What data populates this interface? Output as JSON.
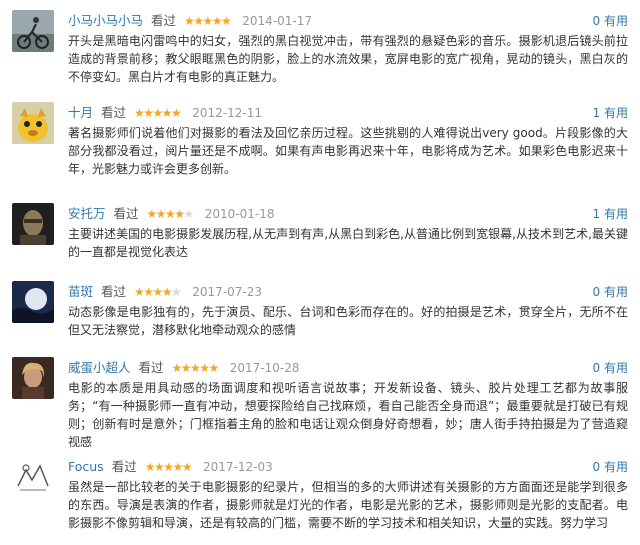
{
  "reviews": [
    {
      "user": "小马小马小马",
      "verb": "看过",
      "rating": 5,
      "date": "2014-01-17",
      "useful": "0 有用",
      "avatar": "cyclist-photo",
      "text": "开头是黑暗电闪雷鸣中的妇女，强烈的黑白视觉冲击，带有强烈的悬疑色彩的音乐。摄影机退后镜头前拉造成的背景前移；教父眼眶黑色的阴影，脸上的水流效果，宽屏电影的宽广视角，晃动的镜头，黑白灰的不停变幻。黑白片才有电影的真正魅力。"
    },
    {
      "user": "十月",
      "verb": "看过",
      "rating": 5,
      "date": "2012-12-11",
      "useful": "1 有用",
      "avatar": "yellow-mascot",
      "text": "著名摄影师们说着他们对摄影的看法及回忆亲历过程。这些挑剔的人难得说出very good。片段影像的大部分我都没看过，阅片量还是不成啊。如果有声电影再迟来十年，电影将成为艺术。如果彩色电影迟来十年，光影魅力或许会更多创新。"
    },
    {
      "user": "安托万",
      "verb": "看过",
      "rating": 4,
      "date": "2010-01-18",
      "useful": "1 有用",
      "avatar": "dark-portrait",
      "text": "主要讲述美国的电影摄影发展历程,从无声到有声,从黑白到彩色,从普通比例到宽银幕,从技术到艺术,最关键的一直都是视觉化表达"
    },
    {
      "user": "苗斑",
      "verb": "看过",
      "rating": 4,
      "date": "2017-07-23",
      "useful": "0 有用",
      "avatar": "moon-night",
      "text": "动态影像是电影独有的，先于演员、配乐、台词和色彩而存在的。好的拍摄是艺术，贯穿全片，无所不在但又无法察觉，潜移默化地牵动观众的感情"
    },
    {
      "user": "威蛋小超人",
      "verb": "看过",
      "rating": 5,
      "date": "2017-10-28",
      "useful": "0 有用",
      "avatar": "woman-portrait",
      "text": "电影的本质是用具动感的场面调度和视听语言说故事；开发新设备、镜头、胶片处理工艺都为故事服务；“有一种摄影师一直有冲动，想要探险给自己找麻烦，看自己能否全身而退”；最重要就是打破已有规则；创新有时是意外；门框指着主角的脸和电话让观众倒身好奇想看，妙；唐人街手持拍摄是为了营造窥视感"
    },
    {
      "user": "Focus",
      "verb": "看过",
      "rating": 5,
      "date": "2017-12-03",
      "useful": "0 有用",
      "avatar": "sketch-figure",
      "text": "虽然是一部比较老的关于电影摄影的纪录片，但相当的多的大师讲述有关摄影的方方面面还是能学到很多的东西。导演是表演的作者，摄影师就是灯光的作者，电影是光影的艺术，摄影师则是光影的支配者。电影摄影不像剪辑和导演，还是有较高的门槛，需要不断的学习技术和相关知识，大量的实践。努力学习"
    }
  ]
}
